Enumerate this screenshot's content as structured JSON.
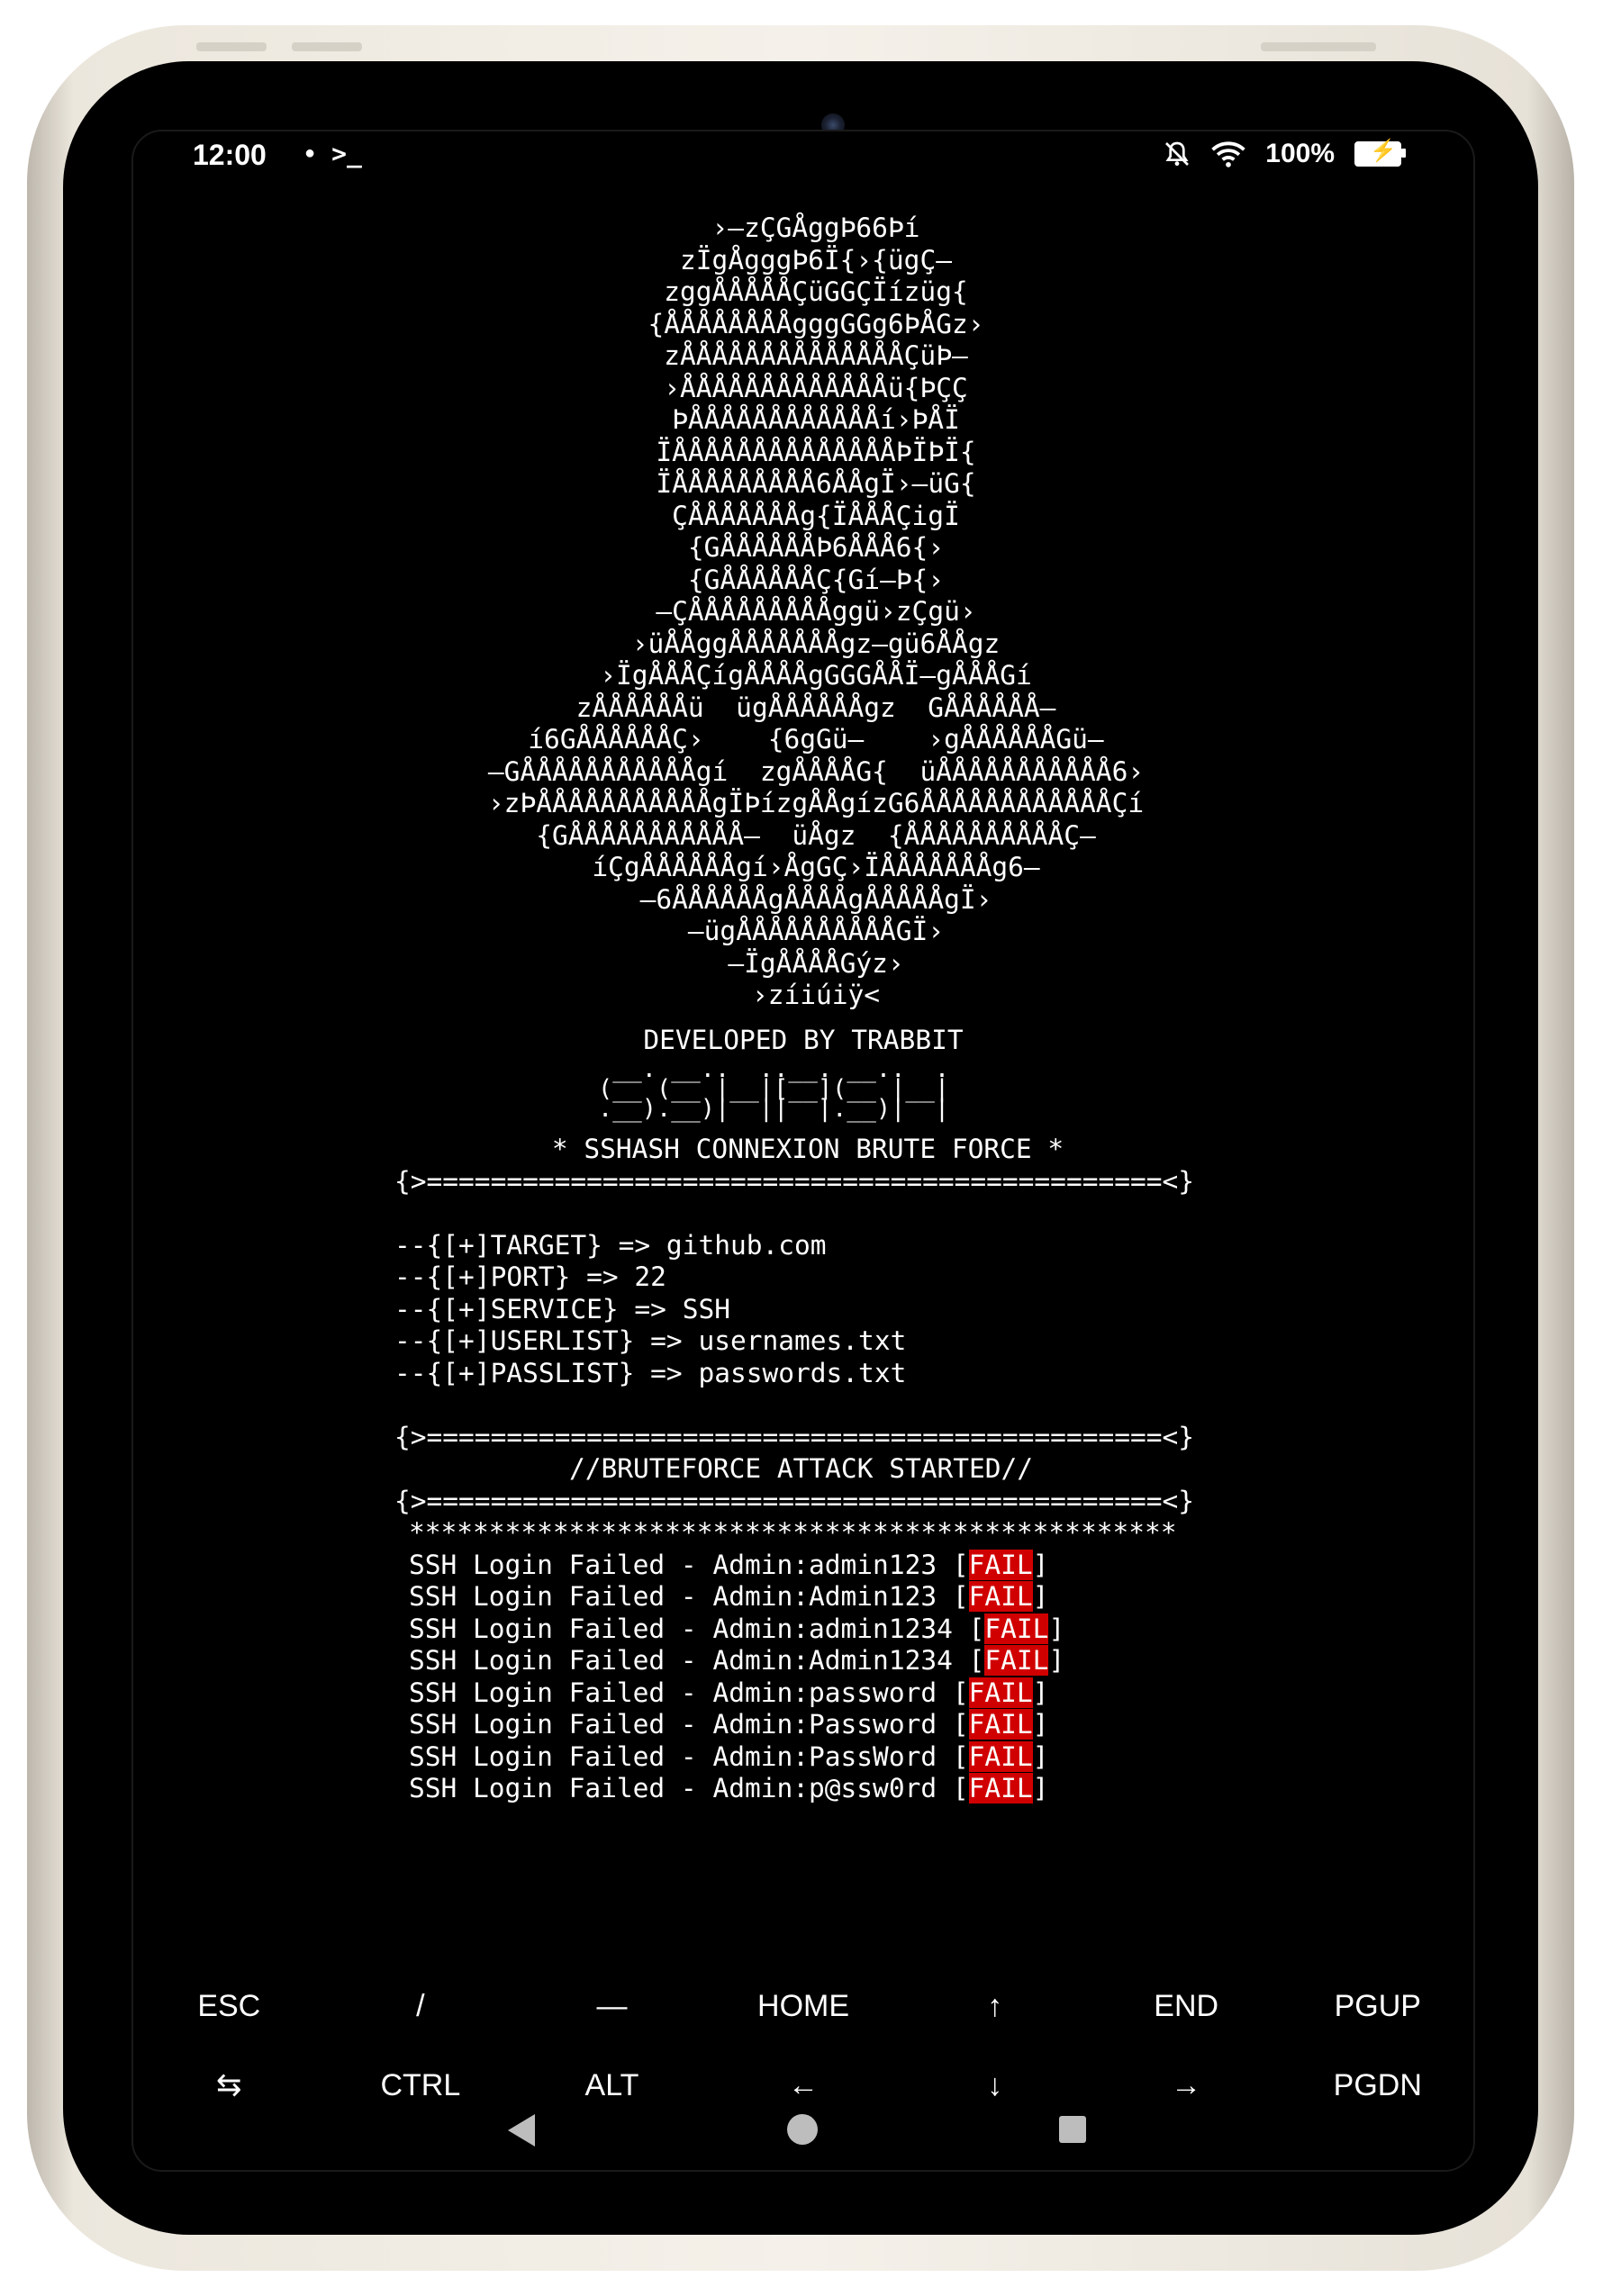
{
  "status_bar": {
    "time": "12:00",
    "left_icons": [
      "notification-dot-icon",
      "terminal-prompt-icon"
    ],
    "left_glyphs": [
      "●",
      ">_"
    ],
    "battery_text": "100%",
    "right_icons": [
      "silent-bell-icon",
      "wifi-icon",
      "battery-charging-icon"
    ]
  },
  "terminal": {
    "ascii_art": [
      "›—zÇGÅggÞ66Þí",
      "zÏgÅgggÞ6Ï{›{ügÇ—",
      "zggÅÅÅÅÅÇüGGÇÏízüg{",
      "{ÅÅÅÅÅÅÅÅgggGGg6ÞÅGz›",
      "zÅÅÅÅÅÅÅÅÅÅÅÅÅÅÇüÞ—",
      "›ÅÅÅÅÅÅÅÅÅÅÅÅÅü{ÞÇÇ",
      "ÞÅÅÅÅÅÅÅÅÅÅÅÅí›ÞÅÏ",
      "ÏÅÅÅÅÅÅÅÅÅÅÅÅÅÅÞÏÞÏ{",
      "ÏÅÅÅÅÅÅÅÅÅ6ÅÅgÏ›—üG{",
      "ÇÅÅÅÅÅÅÅg{ÏÅÅÅÇigÏ",
      "{GÅÅÅÅÅÅÞ6ÅÅÅ6{›",
      "{GÅÅÅÅÅÅÇ{Gí—Þ{›",
      "—ÇÅÅÅÅÅÅÅÅÅggü›zÇgü›",
      "›üÅÅggÅÅÅÅÅÅÅgz—gü6ÅÅgz",
      "›ÏgÅÅÅÇígÅÅÅÅgGGGÅÅÏ—gÅÅÅGí",
      "zÅÅÅÅÅÅü  ügÅÅÅÅÅÅgz  GÅÅÅÅÅÅ—",
      "í6GÅÅÅÅÅÅÇ›    {6gGü—    ›gÅÅÅÅÅÅGü—",
      "—GÅÅÅÅÅÅÅÅÅÅÅgí  zgÅÅÅÅG{  üÅÅÅÅÅÅÅÅÅÅÅ6›",
      "›zÞÅÅÅÅÅÅÅÅÅÅÅgÏÞízgÅÅgízG6ÅÅÅÅÅÅÅÅÅÅÅÅÇí",
      "{GÅÅÅÅÅÅÅÅÅÅÅ—  üÅgz  {ÅÅÅÅÅÅÅÅÅÅÇ—",
      "íÇgÅÅÅÅÅÅgí›ÅgGÇ›ÏÅÅÅÅÅÅÅg6—",
      "—6ÅÅÅÅÅÅgÅÅÅÅgÅÅÅÅÅgÏ›",
      "—ügÅÅÅÅÅÅÅÅÅÅGÏ›",
      "—ÏgÅÅÅÅGýz›",
      "›zíiúiÿ<"
    ],
    "developer_line": "DEVELOPED BY TRABBIT",
    "logo_lines": [
      " __. __..  ..__. __..  . ",
      "(__ (__ |__|[__](__ |__|",
      ".__).__)|  ||  |.__)|  |"
    ],
    "title": "* SSHASH CONNEXION BRUTE FORCE *",
    "separator": "{>==============================================<}",
    "config": [
      "--{[+]TARGET} => github.com",
      "--{[+]PORT} => 22",
      "--{[+]SERVICE} => SSH",
      "--{[+]USERLIST} => usernames.txt",
      "--{[+]PASSLIST} => passwords.txt"
    ],
    "attack_started": "//BRUTEFORCE ATTACK STARTED//",
    "stars": "************************************************",
    "attempts": [
      {
        "text": "SSH Login Failed - Admin:admin123 [",
        "status": "FAIL",
        "close": "]"
      },
      {
        "text": "SSH Login Failed - Admin:Admin123 [",
        "status": "FAIL",
        "close": "]"
      },
      {
        "text": "SSH Login Failed - Admin:admin1234 [",
        "status": "FAIL",
        "close": "]"
      },
      {
        "text": "SSH Login Failed - Admin:Admin1234 [",
        "status": "FAIL",
        "close": "]"
      },
      {
        "text": "SSH Login Failed - Admin:password [",
        "status": "FAIL",
        "close": "]"
      },
      {
        "text": "SSH Login Failed - Admin:Password [",
        "status": "FAIL",
        "close": "]"
      },
      {
        "text": "SSH Login Failed - Admin:PassWord [",
        "status": "FAIL",
        "close": "]"
      },
      {
        "text": "SSH Login Failed - Admin:p@ssw0rd [",
        "status": "FAIL",
        "close": "]"
      }
    ]
  },
  "extra_keys": {
    "row1": [
      "ESC",
      "/",
      "—",
      "HOME",
      "↑",
      "END",
      "PGUP"
    ],
    "row2": [
      "⇆",
      "CTRL",
      "ALT",
      "←",
      "↓",
      "→",
      "PGDN"
    ]
  },
  "colors": {
    "fail_bg": "#d10000",
    "terminal_bg": "#000000",
    "terminal_fg": "#ffffff"
  }
}
